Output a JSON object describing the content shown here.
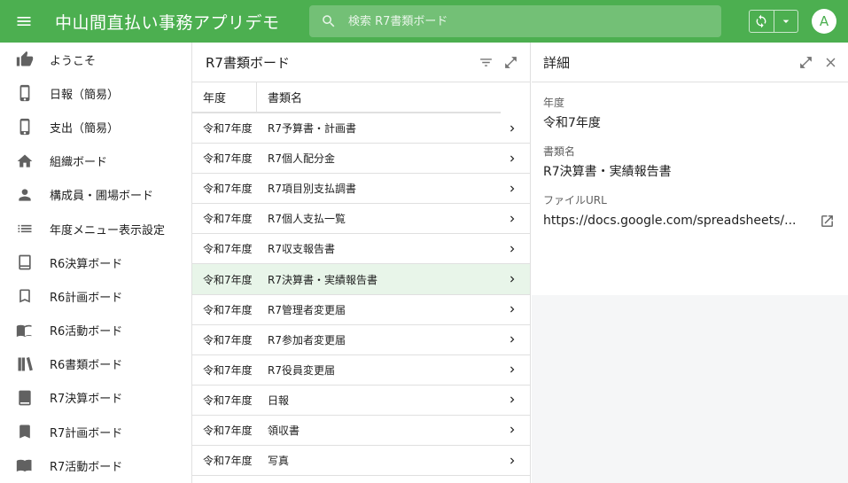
{
  "app": {
    "title": "中山間直払い事務アプリデモ",
    "search_placeholder": "検索 R7書類ボード",
    "avatar_letter": "A",
    "accent_color": "#4caf50"
  },
  "sidebar": {
    "items": [
      {
        "label": "ようこそ",
        "icon": "thumbs-up-icon"
      },
      {
        "label": "日報（簡易）",
        "icon": "phone-icon"
      },
      {
        "label": "支出（簡易）",
        "icon": "phone-icon"
      },
      {
        "label": "組織ボード",
        "icon": "home-icon"
      },
      {
        "label": "構成員・圃場ボード",
        "icon": "person-icon"
      },
      {
        "label": "年度メニュー表示設定",
        "icon": "list-icon"
      },
      {
        "label": "R6決算ボード",
        "icon": "book-outline-icon"
      },
      {
        "label": "R6計画ボード",
        "icon": "bookmark-outline-icon"
      },
      {
        "label": "R6活動ボード",
        "icon": "open-book-outline-icon"
      },
      {
        "label": "R6書類ボード",
        "icon": "library-outline-icon"
      },
      {
        "label": "R7決算ボード",
        "icon": "book-filled-icon"
      },
      {
        "label": "R7計画ボード",
        "icon": "bookmark-filled-icon"
      },
      {
        "label": "R7活動ボード",
        "icon": "open-book-filled-icon"
      }
    ]
  },
  "list": {
    "title": "R7書類ボード",
    "columns": [
      "年度",
      "書類名"
    ],
    "rows": [
      {
        "year": "令和7年度",
        "name": "R7予算書・計画書"
      },
      {
        "year": "令和7年度",
        "name": "R7個人配分金"
      },
      {
        "year": "令和7年度",
        "name": "R7項目別支払調書"
      },
      {
        "year": "令和7年度",
        "name": "R7個人支払一覧"
      },
      {
        "year": "令和7年度",
        "name": "R7収支報告書"
      },
      {
        "year": "令和7年度",
        "name": "R7決算書・実績報告書"
      },
      {
        "year": "令和7年度",
        "name": "R7管理者変更届"
      },
      {
        "year": "令和7年度",
        "name": "R7参加者変更届"
      },
      {
        "year": "令和7年度",
        "name": "R7役員変更届"
      },
      {
        "year": "令和7年度",
        "name": "日報"
      },
      {
        "year": "令和7年度",
        "name": "領収書"
      },
      {
        "year": "令和7年度",
        "name": "写真"
      }
    ],
    "selected_index": 5
  },
  "detail": {
    "title": "詳細",
    "fields": {
      "year_label": "年度",
      "year_value": "令和7年度",
      "name_label": "書類名",
      "name_value": "R7決算書・実績報告書",
      "url_label": "ファイルURL",
      "url_value": "https://docs.google.com/spreadsheets/..."
    }
  }
}
